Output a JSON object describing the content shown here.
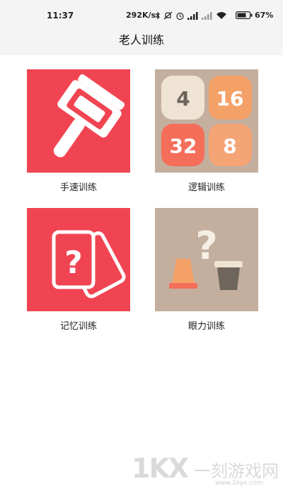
{
  "status_bar": {
    "time": "11:37",
    "net_speed": "292K/s",
    "battery": "67%",
    "icons": [
      "bluetooth-icon",
      "mute-icon",
      "alarm-icon",
      "signal-icon",
      "signal-icon",
      "wifi-icon",
      "battery-icon"
    ]
  },
  "header": {
    "title": "老人训练"
  },
  "tiles": [
    {
      "label": "手速训练",
      "icon": "gavel-icon",
      "bg": "#f04452"
    },
    {
      "label": "逻辑训练",
      "icon": "2048-grid-icon",
      "bg": "#c4af9e",
      "numbers": [
        "4",
        "16",
        "32",
        "8"
      ]
    },
    {
      "label": "记忆训练",
      "icon": "question-cards-icon",
      "bg": "#f04452"
    },
    {
      "label": "眼力训练",
      "icon": "cups-question-icon",
      "bg": "#c4af9e"
    }
  ],
  "watermark": {
    "logo": "1KX",
    "site_name": "一刻游戏网",
    "url": "www.1kyx.com"
  }
}
